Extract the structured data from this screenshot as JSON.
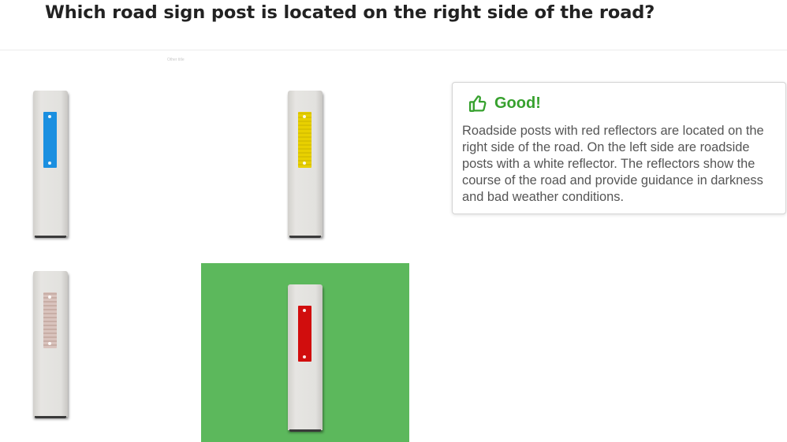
{
  "question": {
    "title": "Which road sign post is located on the right side of the road?"
  },
  "image_credit": "Other title",
  "options": [
    {
      "id": "blue",
      "reflector_color": "#1a8fe0",
      "selected": false,
      "correct": false
    },
    {
      "id": "yellow",
      "reflector_color": "#e8d000",
      "selected": false,
      "correct": false
    },
    {
      "id": "white",
      "reflector_color": "#d9c3bd",
      "selected": false,
      "correct": false
    },
    {
      "id": "red",
      "reflector_color": "#d10d0d",
      "selected": true,
      "correct": true
    }
  ],
  "feedback": {
    "icon": "thumbs-up-icon",
    "title": "Good!",
    "text": "Roadside posts with red reflectors are located on the right side of the road. On the left side are roadside posts with a white reflector. The reflectors show the course of the road and provide guidance in darkness and bad weather conditions."
  },
  "colors": {
    "correct_highlight": "#5cb85c",
    "feedback_title": "#37a12e"
  }
}
